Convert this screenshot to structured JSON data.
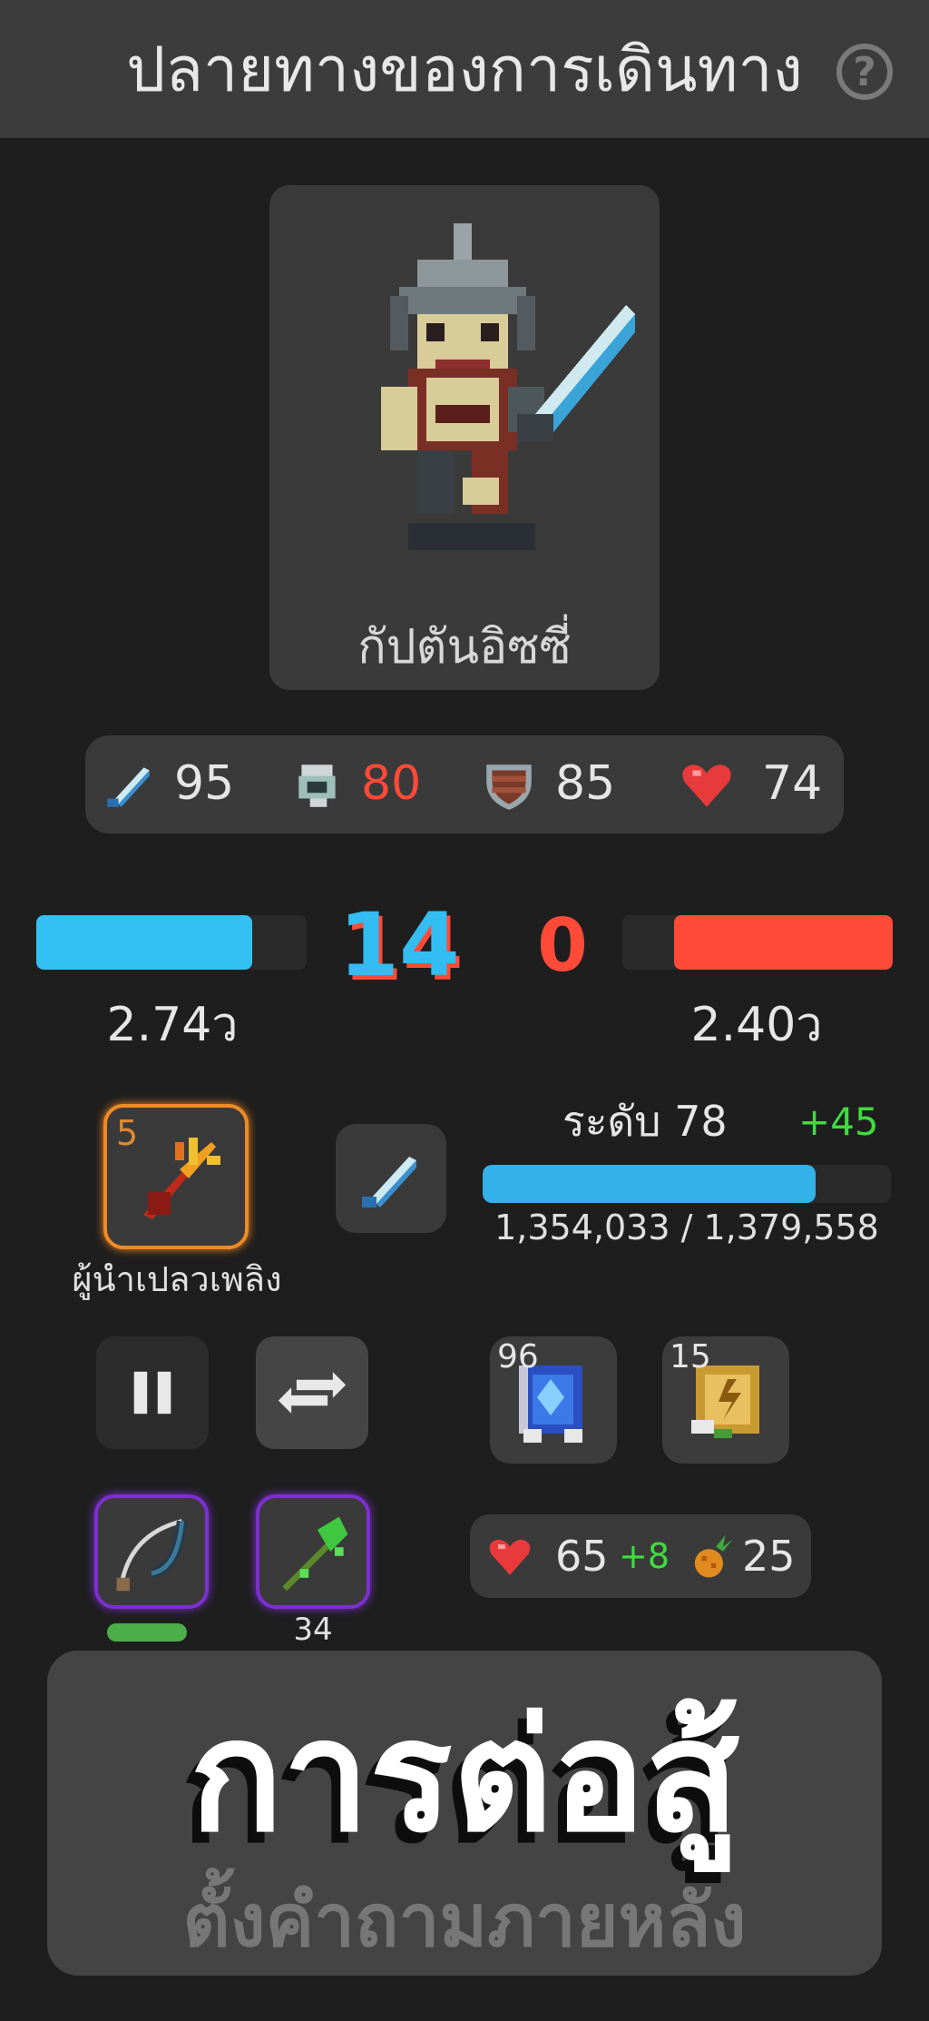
{
  "header": {
    "title": "ปลายทางของการเดินทาง",
    "help_label": "?"
  },
  "hero": {
    "name": "กัปตันอิซซี่",
    "sprite": "armored-captain-with-sword"
  },
  "stats": [
    {
      "icon": "sword-icon",
      "value": "95",
      "color": "#e6e6e6"
    },
    {
      "icon": "helmet-icon",
      "value": "80",
      "color": "#ff4a38"
    },
    {
      "icon": "shield-icon",
      "value": "85",
      "color": "#e6e6e6"
    },
    {
      "icon": "heart-icon",
      "value": "74",
      "color": "#e6e6e6"
    }
  ],
  "battle": {
    "player_fill_fraction": 0.8,
    "enemy_fill_fraction": 0.81,
    "player_score": "14",
    "enemy_score": "0",
    "player_timer": "2.74ว",
    "enemy_timer": "2.40ว",
    "player_color": "#33c0f2",
    "enemy_color": "#ff4a38"
  },
  "skill": {
    "count": "5",
    "name": "ผู้นำเปลวเพลิง",
    "icon": "fire-trident-icon"
  },
  "weapon": {
    "icon": "sword-icon"
  },
  "level": {
    "label": "ระดับ 78",
    "gain": "+45",
    "xp_text": "1,354,033 / 1,379,558",
    "xp_fraction": 0.8165
  },
  "controls": {
    "pause_icon": "pause-icon",
    "swap_icon": "swap-arrows-icon"
  },
  "items": [
    {
      "icon": "blue-tome-icon",
      "count": "96"
    },
    {
      "icon": "gold-scroll-icon",
      "count": "15"
    }
  ],
  "equipment": [
    {
      "icon": "bow-icon",
      "cooldown_fraction": 1.0
    },
    {
      "icon": "green-hoe-icon",
      "count": "34"
    }
  ],
  "resources": {
    "hp_value": "65",
    "hp_gain": "+8",
    "food_value": "25",
    "hp_icon": "heart-icon",
    "food_icon": "pineapple-icon"
  },
  "fight": {
    "label": "การต่อสู้",
    "sublabel": "ตั้งคำถามภายหลัง"
  }
}
